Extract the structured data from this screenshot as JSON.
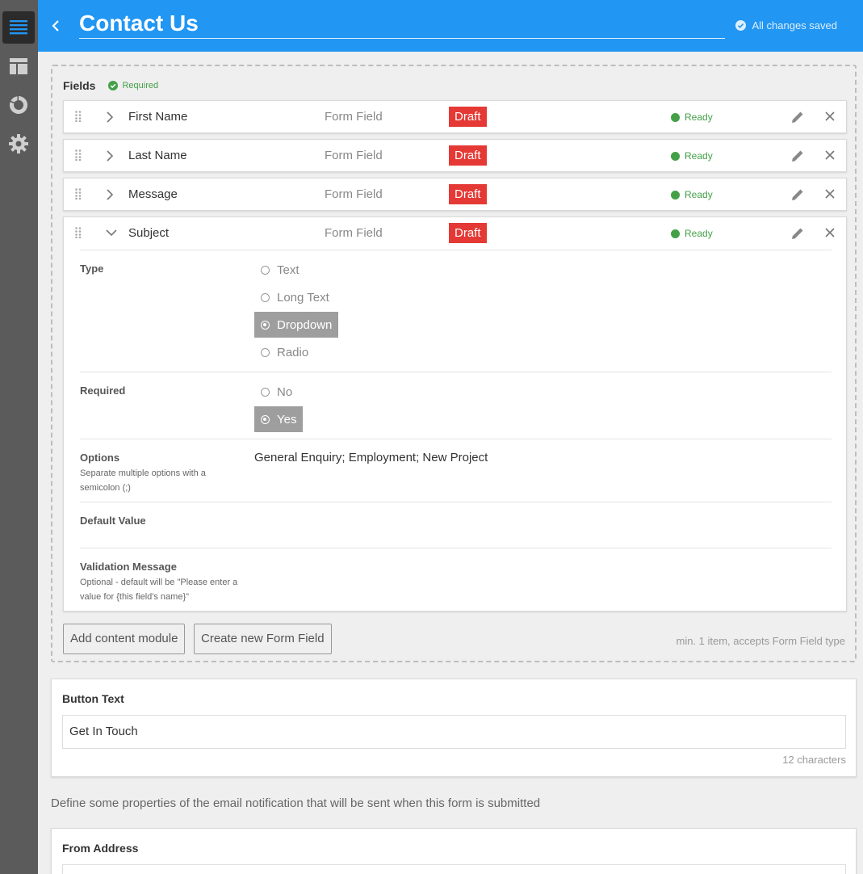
{
  "header": {
    "title": "Contact Us",
    "saved_status": "All changes saved"
  },
  "rail": {
    "items": [
      "content-icon",
      "layout-icon",
      "chart-icon",
      "gear-icon"
    ],
    "active": "content-icon"
  },
  "fields": {
    "label": "Fields",
    "required_badge": "Required",
    "rows": [
      {
        "name": "First Name",
        "type": "Form Field",
        "status": "Draft",
        "state": "Ready"
      },
      {
        "name": "Last Name",
        "type": "Form Field",
        "status": "Draft",
        "state": "Ready"
      },
      {
        "name": "Message",
        "type": "Form Field",
        "status": "Draft",
        "state": "Ready"
      },
      {
        "name": "Subject",
        "type": "Form Field",
        "status": "Draft",
        "state": "Ready"
      }
    ],
    "expanded": {
      "type_label": "Type",
      "type_options": [
        "Text",
        "Long Text",
        "Dropdown",
        "Radio"
      ],
      "type_selected": "Dropdown",
      "required_label": "Required",
      "required_options": [
        "No",
        "Yes"
      ],
      "required_selected": "Yes",
      "options_label": "Options",
      "options_hint": "Separate multiple options with a semicolon (;)",
      "options_value": "General Enquiry; Employment; New Project",
      "default_label": "Default Value",
      "validation_label": "Validation Message",
      "validation_hint": "Optional - default will be \"Please enter a value for {this field's name}\""
    },
    "add_module_button": "Add content module",
    "create_field_button": "Create new Form Field",
    "constraint": "min. 1 item, accepts Form Field type"
  },
  "button_text": {
    "label": "Button Text",
    "value": "Get In Touch",
    "char_count": "12 characters"
  },
  "notification_intro": "Define some properties of the email notification that will be sent when this form is submitted",
  "from_address": {
    "label": "From Address"
  },
  "colors": {
    "header": "#2196f3",
    "rail": "#5b5b5b",
    "draft": "#e53935",
    "ready": "#43a047"
  }
}
